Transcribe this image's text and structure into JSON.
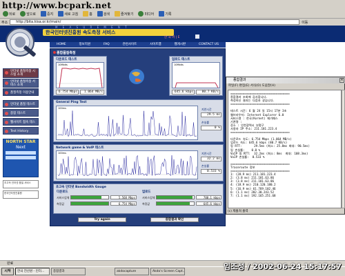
{
  "watermark": "http://www.bcpark.net",
  "browser": {
    "toolbar": [
      "뒤로",
      "앞으로",
      "중지",
      "새로 고침",
      "홈",
      "검색",
      "즐겨찾기",
      "미디어",
      "기록"
    ],
    "address_label": "주소",
    "address": "http://bita.kisa.or.kr/main/",
    "go_label": "이동",
    "status": "완료"
  },
  "site": {
    "title": "한국인터넷진흥원 속도측정 서비스",
    "tagline": "M E A S U R E M E N T",
    "lang_link": "한 국 어 | E",
    "nav": [
      "HOME",
      "정보지원",
      "FAQ",
      "관련사이트",
      "사이트맵",
      "웹게시판",
      "CONTACT US"
    ],
    "side": [
      {
        "label": "인터넷 품질측정 시스템 소개",
        "style": "red"
      },
      {
        "label": "인터넷 품질측정 서비스 소개",
        "style": "normal"
      },
      {
        "label": "품질측정 이용안내",
        "style": "dark"
      },
      {
        "label": "인터넷 품질 테스트",
        "style": "normal"
      },
      {
        "label": "종합 테스트",
        "style": "normal"
      },
      {
        "label": "웹사이트 접속 테스트",
        "style": "normal"
      },
      {
        "label": "Test History",
        "style": "normal"
      }
    ],
    "banner": {
      "title": "NORTH STAR",
      "sub": "Next"
    },
    "ads": [
      "초고속 인터넷 품질 서비스",
      "한국인터넷진흥원"
    ]
  },
  "panel": {
    "heading": "종합품질측정",
    "download": {
      "title": "다운로드 테스트",
      "scale": "10Mbits",
      "rate1": "6.754 Mbps",
      "rate2": "1.064 MB/s"
    },
    "upload": {
      "title": "업로드 테스트",
      "scale": "10Mbits",
      "rate1": "645.6 kbps",
      "rate2": "80.7 KB/s"
    },
    "ping": {
      "title": "General Ping Test",
      "scale": "100ms",
      "avg_label": "지연시간",
      "avg": "29.5 ms",
      "loss_label": "손실률",
      "loss": "0 %"
    },
    "voip": {
      "title": "Network game & VoIP 테스트",
      "scale": "100ms",
      "avg_label": "지연시간",
      "avg": "32.2 ms",
      "loss_label": "손실률",
      "loss": "0.533 %"
    },
    "gauge": {
      "title": "초고속 인터넷 Bandwidth Gauge",
      "dl_head": "다운로드",
      "ul_head": "업로드",
      "row_labels": [
        "서비스업체",
        "측정값"
      ],
      "dl": [
        {
          "value": "5.568 Mbps",
          "fraction": 0.82
        },
        {
          "value": "6.754 Mbps",
          "fraction": 1.0
        }
      ],
      "ul": [
        {
          "value": "700.1 kbps",
          "fraction": 0.96
        },
        {
          "value": "645.6 kbps",
          "fraction": 0.88
        }
      ]
    },
    "try_again": "Try again",
    "result_btn": "종합결과 확인"
  },
  "result_window": {
    "title": "종합결과",
    "menu": "파일(F)  편집(E)  서식(O)  도움말(H)",
    "status": "(c) 제출처 출력",
    "text": [
      "==================================",
      "종합결과 조회에 감사합니다.",
      "측정하신 결과는 다음과 같습니다.",
      "==================================",
      "",
      "테스트 시간: 6 월 24 일 15시 17분 3초",
      "웹브라우저: Internet Explorer 6.0",
      "서비스명 : 한국(Kornet) 메가패스",
      "기관명 :",
      "장소 : 인천광역시 부평구",
      "사용자 IP 주소: 211.181.223.4",
      "==================================",
      "",
      "다운로드 속도: 6.754 Mbps (1.064 MB/s)",
      "업로드 속도: 645.6 kbps (80.7 KB/s)",
      "핑 RTT:       29.5ms (최소: 25.8ms 최대: 90.5ms)",
      "핑 손실률:    0.0 %",
      "VoIP 핑 RTT:  32.2ms (최소: 8ms  최대: 108.3ms)",
      "VoIP 손실률:  0.533 %",
      "",
      "==================================",
      "Traceroute 정보",
      "==================================",
      "1: (28.9 ms) 211.181.223.4",
      "2: (3.8 ms) 211.181.63.86",
      "3: (3.8 ms) 211.181.63.86",
      "4: (18.9 ms) 210.120.180.2",
      "5: (16.9 ms) 61.769.102.46",
      "6: (1.1 ms) 202.30.243.52",
      "7: (1.1 ms) 192.165.251.68"
    ]
  },
  "taskbar": {
    "start": "시작",
    "tasks": [
      "한국 전산원 - 인터...",
      "종합결과",
      "akdocapture",
      "Akdo's Screen Capt..."
    ]
  },
  "clock": "임조성 / 2002-06-24 15:17:57"
}
